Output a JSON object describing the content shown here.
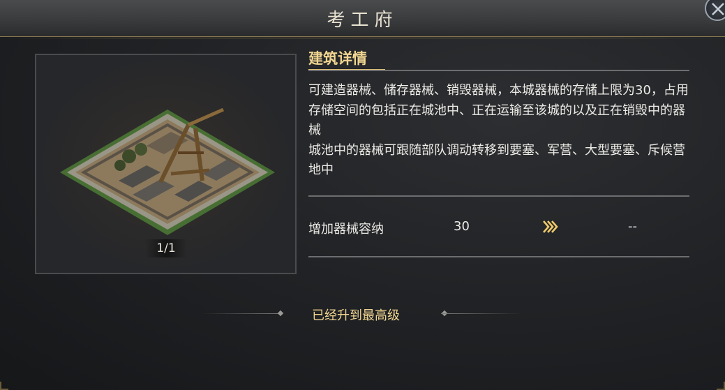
{
  "window": {
    "title": "考工府"
  },
  "building": {
    "page_indicator": "1/1",
    "image_icon": "siege-workshop-building"
  },
  "details": {
    "heading": "建筑详情",
    "paragraphs": [
      "可建造器械、储存器械、销毁器械，本城器械的存储上限为30，占用存储空间的包括正在城池中、正在运输至该城的以及正在销毁中的器械",
      "城池中的器械可跟随部队调动转移到要塞、军营、大型要塞、斥候营地中"
    ]
  },
  "stat": {
    "label": "增加器械容纳",
    "current_value": "30",
    "next_value": "--",
    "arrow_icon": "triple-chevron-right-icon"
  },
  "footer": {
    "max_level_text": "已经升到最高级"
  },
  "colors": {
    "accent_gold": "#f0d590",
    "text": "#ecebe6",
    "background": "#212326"
  }
}
